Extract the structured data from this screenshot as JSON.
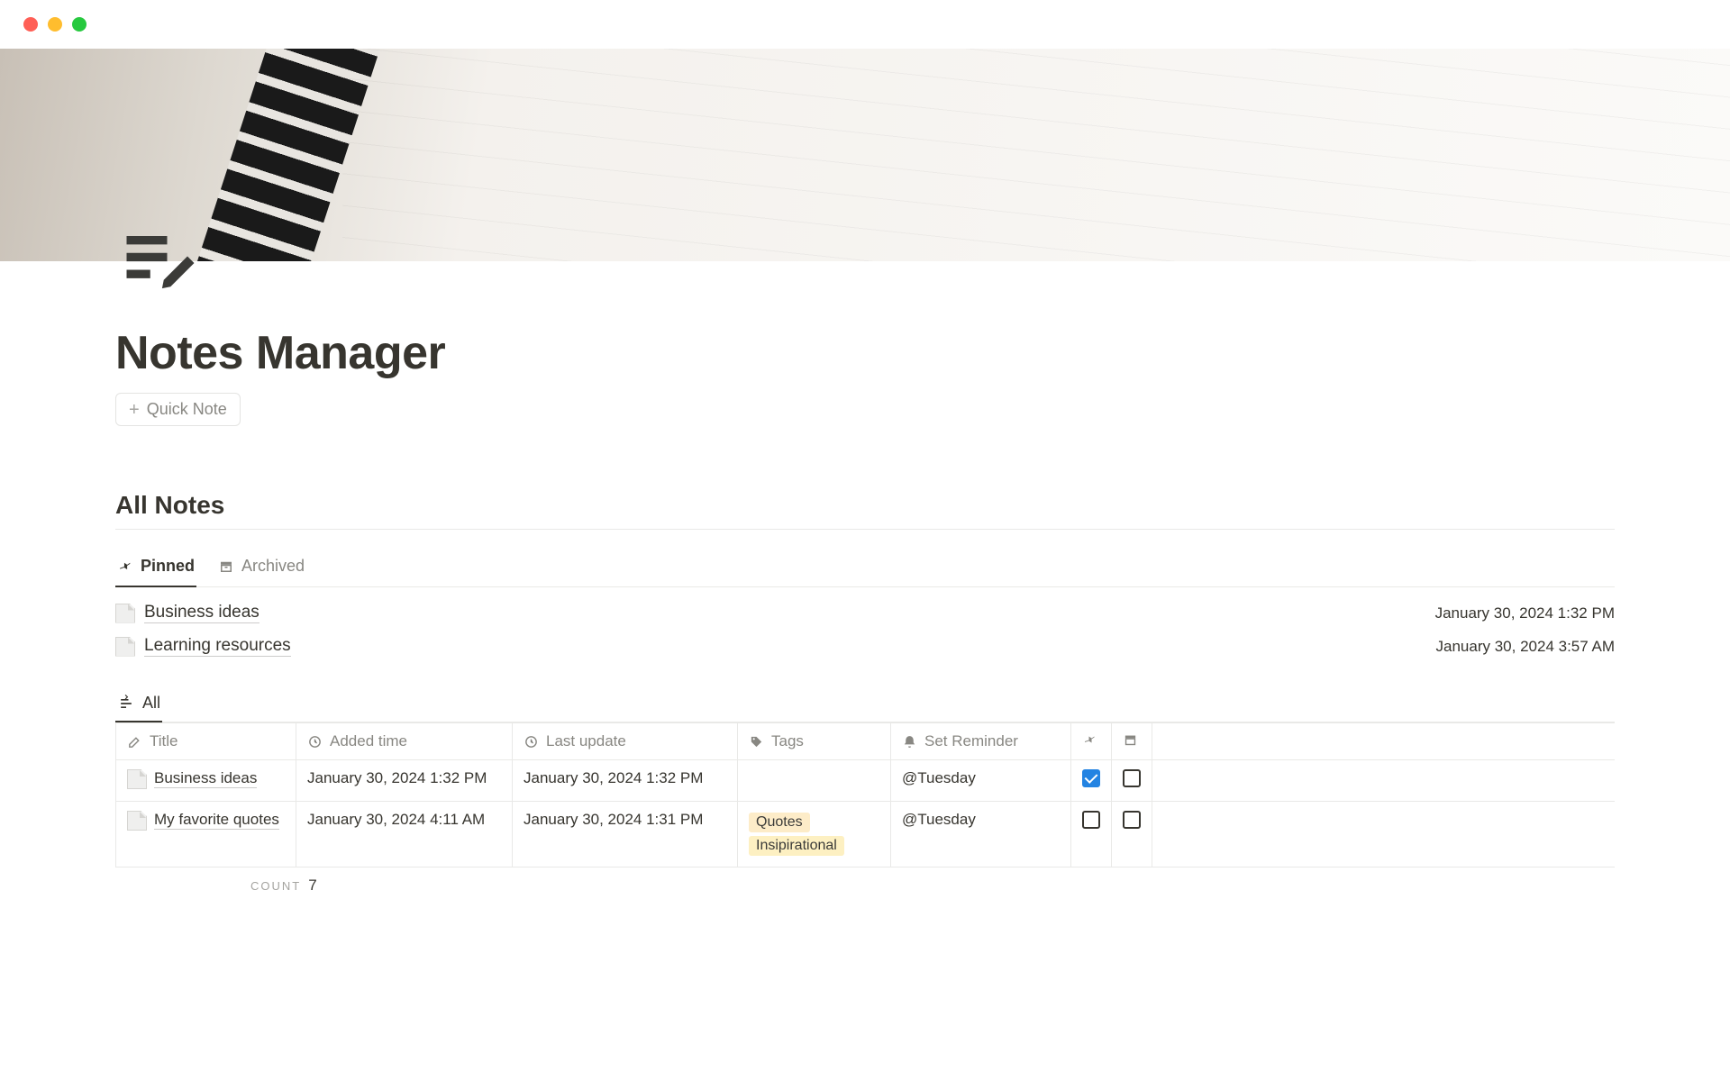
{
  "page": {
    "title": "Notes Manager",
    "quick_note_label": "Quick Note",
    "section_title": "All Notes"
  },
  "tabs": {
    "pinned": "Pinned",
    "archived": "Archived"
  },
  "pinned_items": [
    {
      "title": "Business ideas",
      "date": "January 30, 2024 1:32 PM"
    },
    {
      "title": "Learning resources",
      "date": "January 30, 2024 3:57 AM"
    }
  ],
  "view_tab": {
    "all": "All"
  },
  "columns": {
    "title": "Title",
    "added": "Added time",
    "update": "Last update",
    "tags": "Tags",
    "reminder": "Set Reminder"
  },
  "rows": [
    {
      "title": "Business ideas",
      "added": "January 30, 2024 1:32 PM",
      "update": "January 30, 2024 1:32 PM",
      "tags": [],
      "reminder": "@Tuesday",
      "pinned": true,
      "archived": false
    },
    {
      "title": "My favorite quotes",
      "added": "January 30, 2024 4:11 AM",
      "update": "January 30, 2024 1:31 PM",
      "tags": [
        "Quotes",
        "Insipirational"
      ],
      "reminder": "@Tuesday",
      "pinned": false,
      "archived": false
    }
  ],
  "count": {
    "label": "Count",
    "value": "7"
  }
}
